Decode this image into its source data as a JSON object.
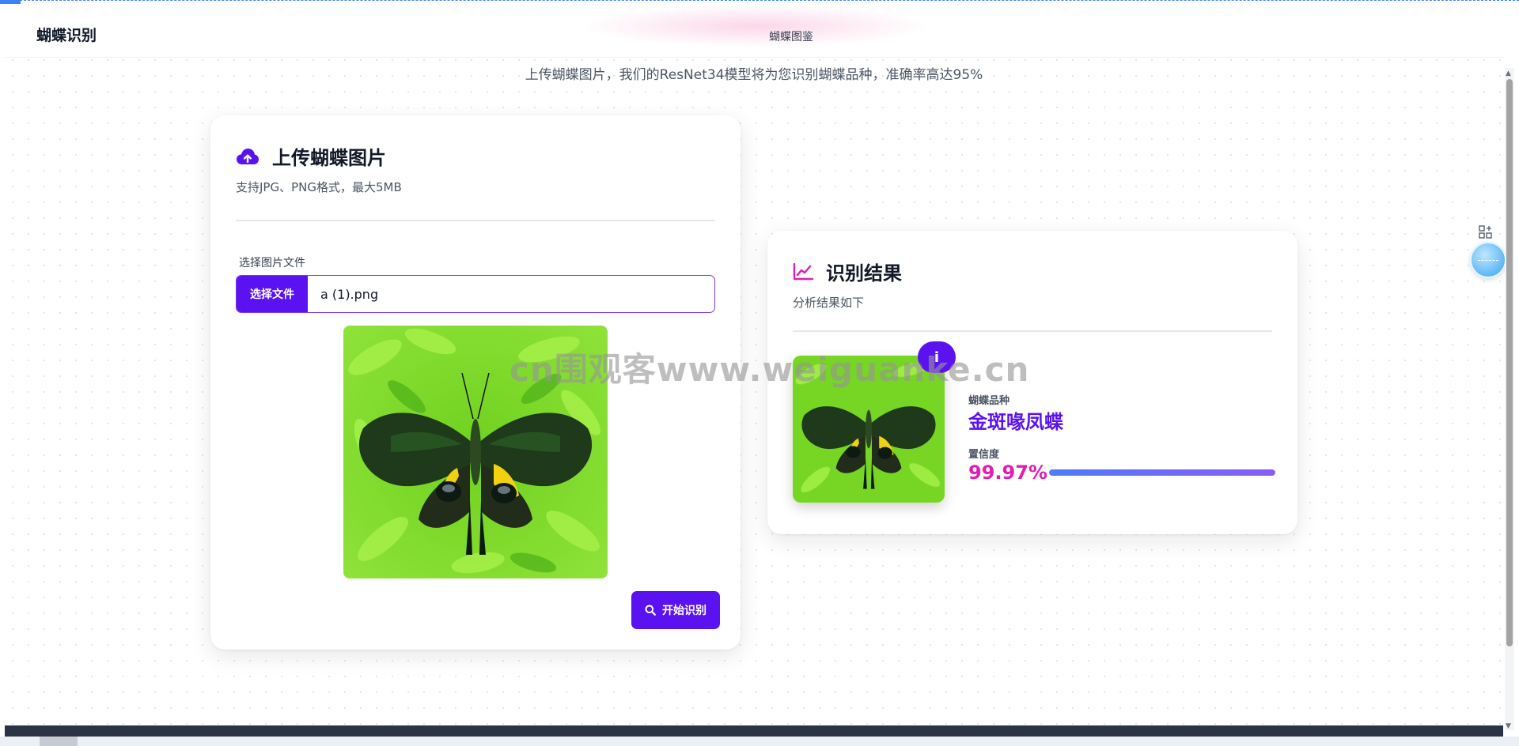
{
  "navbar": {
    "brand": "蝴蝶识别",
    "link": "蝴蝶图鉴"
  },
  "hero": {
    "subtitle": "上传蝴蝶图片，我们的ResNet34模型将为您识别蝴蝶品种，准确率高达95%"
  },
  "upload": {
    "icon": "cloud-upload-icon",
    "title": "上传蝴蝶图片",
    "description": "支持JPG、PNG格式，最大5MB",
    "file_label": "选择图片文件",
    "choose_button": "选择文件",
    "file_name": "a (1).png",
    "start_button": "开始识别"
  },
  "result": {
    "icon": "chart-line-icon",
    "title": "识别结果",
    "description": "分析结果如下",
    "badge_icon": "info-icon",
    "species_label": "蝴蝶品种",
    "species_name": "金斑喙凤蝶",
    "confidence_label": "置信度",
    "confidence_value": "99.97%",
    "confidence_fraction": 0.9997
  },
  "watermark": "cn围观客www.weiguanke.cn",
  "colors": {
    "primary": "#5b12f0",
    "accent_pink": "#e11db5",
    "leaf_green": "#7ed321"
  }
}
